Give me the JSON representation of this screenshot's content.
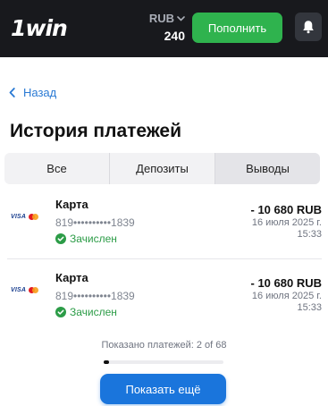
{
  "header": {
    "logo": "1win",
    "currency": "RUB",
    "balance": "240",
    "deposit_label": "Пополнить",
    "colors": {
      "bar": "#18191d",
      "deposit": "#2fb34e"
    }
  },
  "nav": {
    "back_label": "Назад"
  },
  "page": {
    "title": "История платежей"
  },
  "tabs": [
    {
      "label": "Все",
      "active": false
    },
    {
      "label": "Депозиты",
      "active": false
    },
    {
      "label": "Выводы",
      "active": true
    }
  ],
  "payments": [
    {
      "method": "Карта",
      "card_brands": [
        "visa-icon",
        "mastercard-icon"
      ],
      "visa_text": "VISA",
      "masked_number": "819••••••••••1839",
      "status": "Зачислен",
      "amount": "- 10 680 RUB",
      "date": "16 июля 2025 г.",
      "time": "15:33"
    },
    {
      "method": "Карта",
      "card_brands": [
        "visa-icon",
        "mastercard-icon"
      ],
      "visa_text": "VISA",
      "masked_number": "819••••••••••1839",
      "status": "Зачислен",
      "amount": "- 10 680 RUB",
      "date": "16 июля 2025 г.",
      "time": "15:33"
    }
  ],
  "pagination": {
    "shown_text": "Показано платежей: 2 of 68",
    "progress_fraction": 0.0294,
    "more_label": "Показать ещё"
  },
  "colors": {
    "link": "#2a7ad4",
    "status_ok": "#2c9c47",
    "primary": "#1a75dc"
  }
}
